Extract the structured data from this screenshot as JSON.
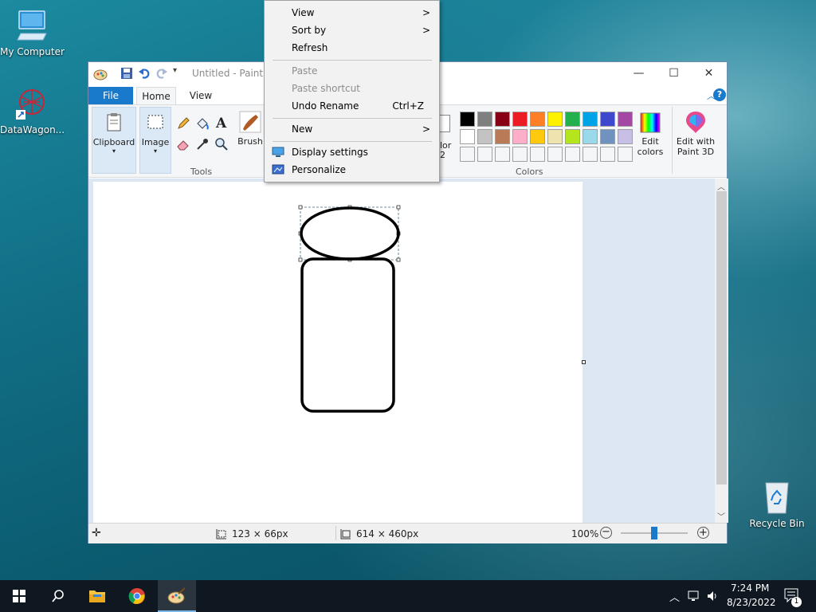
{
  "desktop": {
    "icons": [
      {
        "label": "My Computer"
      },
      {
        "label": "DataWagon..."
      },
      {
        "label": "Recycle Bin"
      }
    ]
  },
  "paint": {
    "title": "Untitled - Paint",
    "tabs": {
      "file": "File",
      "home": "Home",
      "view": "View"
    },
    "ribbon": {
      "clipboard": "Clipboard",
      "image": "Image",
      "tools": "Tools",
      "brushes": "Brush",
      "size_partial": "lor",
      "size_partial2": "2",
      "colors": "Colors",
      "edit_colors_1": "Edit",
      "edit_colors_2": "colors",
      "edit3d_1": "Edit with",
      "edit3d_2": "Paint 3D"
    },
    "palette": {
      "row1": [
        "#000000",
        "#7f7f7f",
        "#880015",
        "#ed1c24",
        "#ff7f27",
        "#fff200",
        "#22b14c",
        "#00a2e8",
        "#3f48cc",
        "#a349a4"
      ],
      "row2": [
        "#ffffff",
        "#c3c3c3",
        "#b97a57",
        "#ffaec9",
        "#ffc90e",
        "#efe4b0",
        "#b5e61d",
        "#99d9ea",
        "#7092be",
        "#c8bfe7"
      ]
    },
    "status": {
      "selection_size": "123 × 66px",
      "image_size": "614 × 460px",
      "zoom": "100%"
    }
  },
  "context_menu": {
    "items": [
      {
        "label": "View",
        "arrow": ">",
        "disabled": false
      },
      {
        "label": "Sort by",
        "arrow": ">",
        "disabled": false
      },
      {
        "label": "Refresh",
        "disabled": false
      },
      {
        "label": "Paste",
        "disabled": true
      },
      {
        "label": "Paste shortcut",
        "disabled": true
      },
      {
        "label": "Undo Rename",
        "shortcut": "Ctrl+Z",
        "disabled": false
      },
      {
        "label": "New",
        "arrow": ">",
        "disabled": false
      },
      {
        "label": "Display settings",
        "disabled": false
      },
      {
        "label": "Personalize",
        "disabled": false
      }
    ]
  },
  "taskbar": {
    "time": "7:24 PM",
    "date": "8/23/2022",
    "notification_count": "1"
  }
}
